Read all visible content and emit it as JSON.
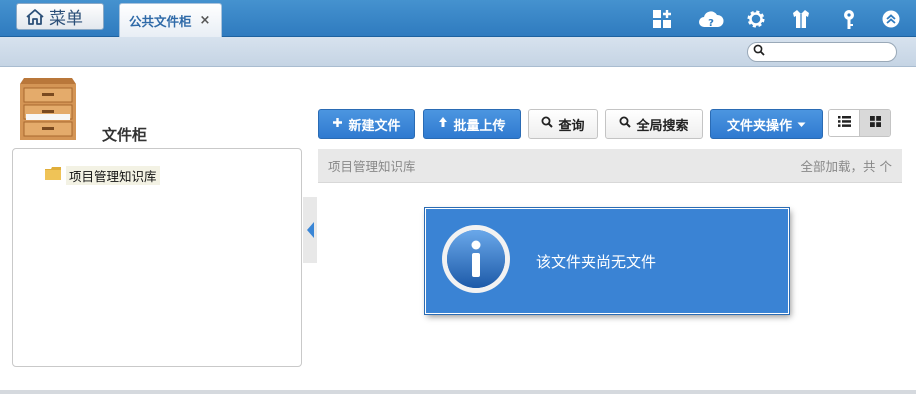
{
  "menu": {
    "label": "菜单"
  },
  "tabs": [
    {
      "label": "公共文件柜",
      "close": "×"
    }
  ],
  "toolbar_icons": [
    "grid-add-icon",
    "cloud-help-icon",
    "gear-icon",
    "shirt-icon",
    "key-icon",
    "collapse-up-icon"
  ],
  "search": {
    "placeholder": ""
  },
  "sidebar": {
    "title": "文件柜",
    "tree": [
      {
        "label": "项目管理知识库"
      }
    ]
  },
  "actions": {
    "new_file": "新建文件",
    "batch_upload": "批量上传",
    "query": "查询",
    "global_search": "全局搜索",
    "folder_ops": "文件夹操作"
  },
  "content": {
    "breadcrumb": "项目管理知识库",
    "status": "全部加载，共 个",
    "empty_message": "该文件夹尚无文件"
  },
  "colors": {
    "accent": "#2f7bbf",
    "button_blue": "#3a86d6",
    "info_blue": "#3a83d4"
  }
}
